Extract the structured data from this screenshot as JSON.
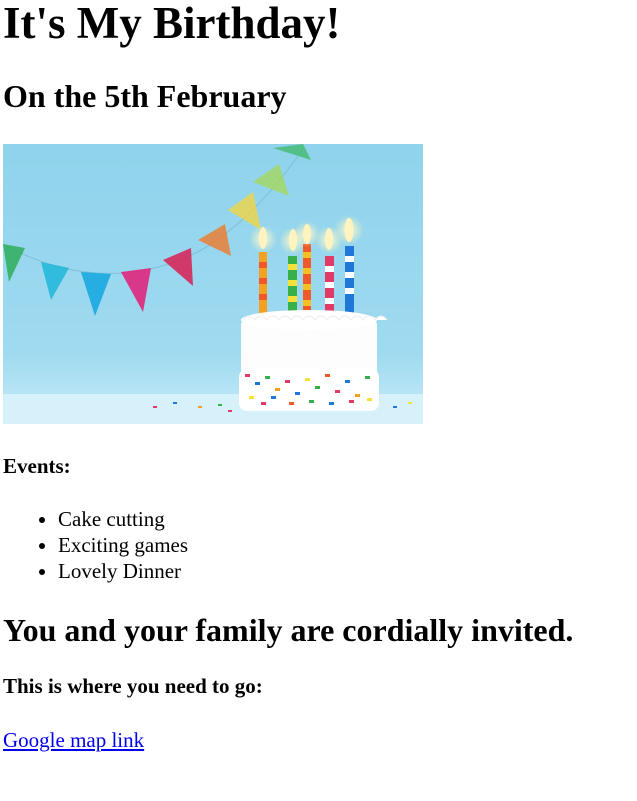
{
  "page": {
    "title": "It's My Birthday!",
    "date_heading": "On the 5th February"
  },
  "events": {
    "heading": "Events:",
    "items": [
      "Cake cutting",
      "Exciting games",
      "Lovely Dinner"
    ]
  },
  "invitation": {
    "heading": "You and your family are cordially invited.",
    "directions_heading": "This is where you need to go:",
    "map_link_text": "Google map link"
  },
  "colors": {
    "link": "#0000ee",
    "text": "#000000",
    "background": "#ffffff",
    "photo_sky": "#8fd3ec"
  },
  "icons": {
    "hero_image": "birthday-cake-photo"
  }
}
